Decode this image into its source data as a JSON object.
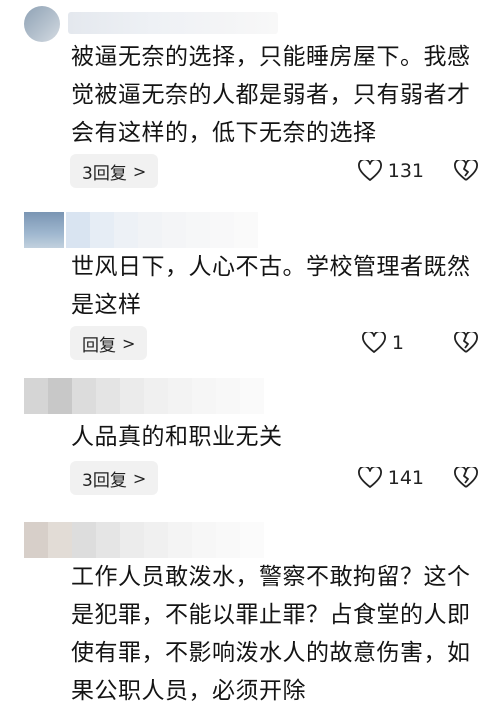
{
  "comments": [
    {
      "lines": [
        "被逼无奈的选择，只能睡房屋下。我感",
        "觉被逼无奈的人都是弱者，只有弱者才",
        "会有这样的，低下无奈的选择"
      ],
      "reply_label": "3回复",
      "likes": "131"
    },
    {
      "lines": [
        "世风日下，人心不古。学校管理者既然",
        "是这样"
      ],
      "reply_label": "回复",
      "likes": "1"
    },
    {
      "lines": [
        "人品真的和职业无关"
      ],
      "reply_label": "3回复",
      "likes": "141"
    },
    {
      "lines": [
        "工作人员敢泼水，警察不敢拘留？这个",
        "是犯罪，不能以罪止罪？占食堂的人即",
        "使有罪，不影响泼水人的故意伤害，如",
        "果公职人员，必须开除"
      ]
    }
  ],
  "icons": {
    "like": "heart-outline-icon",
    "dislike": "broken-heart-icon",
    "expand": "chevron-right-icon"
  },
  "colors": {
    "button_bg": "#f1f1f1",
    "text": "#141414"
  }
}
